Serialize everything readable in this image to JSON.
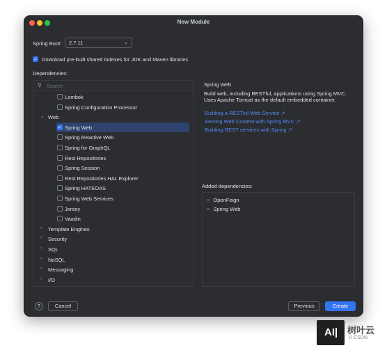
{
  "window": {
    "title": "New Module"
  },
  "spring_boot": {
    "label": "Spring Boot:",
    "value": "2.7.11"
  },
  "download_shared_indexes": {
    "checked": true,
    "label": "Download pre-built shared indexes for JDK and Maven libraries"
  },
  "dependencies": {
    "label": "Dependencies:",
    "search_placeholder": "Search",
    "items": [
      {
        "label": "Lombok",
        "checked": false
      },
      {
        "label": "Spring Configuration Processor",
        "checked": false
      },
      {
        "label": "Web",
        "group": true,
        "expanded": true
      },
      {
        "label": "Spring Web",
        "checked": true,
        "selected": true
      },
      {
        "label": "Spring Reactive Web",
        "checked": false
      },
      {
        "label": "Spring for GraphQL",
        "checked": false
      },
      {
        "label": "Rest Repositories",
        "checked": false
      },
      {
        "label": "Spring Session",
        "checked": false
      },
      {
        "label": "Rest Repositories HAL Explorer",
        "checked": false
      },
      {
        "label": "Spring HATEOAS",
        "checked": false
      },
      {
        "label": "Spring Web Services",
        "checked": false
      },
      {
        "label": "Jersey",
        "checked": false
      },
      {
        "label": "Vaadin",
        "checked": false
      },
      {
        "label": "Template Engines",
        "group": true,
        "expanded": false
      },
      {
        "label": "Security",
        "group": true,
        "expanded": false
      },
      {
        "label": "SQL",
        "group": true,
        "expanded": false
      },
      {
        "label": "NoSQL",
        "group": true,
        "expanded": false
      },
      {
        "label": "Messaging",
        "group": true,
        "expanded": false
      },
      {
        "label": "I/O",
        "group": true,
        "expanded": false
      }
    ]
  },
  "details": {
    "title": "Spring Web",
    "description": "Build web, including RESTful, applications using Spring MVC. Uses Apache Tomcat as the default embedded container.",
    "links": [
      "Building a RESTful Web Service ↗",
      "Serving Web Content with Spring MVC ↗",
      "Building REST services with Spring ↗"
    ]
  },
  "added": {
    "label": "Added dependencies:",
    "items": [
      "OpenFeign",
      "Spring Web"
    ]
  },
  "footer": {
    "help": "?",
    "cancel": "Cancel",
    "previous": "Previous",
    "create": "Create"
  },
  "watermark": {
    "logo": "AI",
    "text": "树叶云",
    "sub": "© CSDN"
  },
  "colors": {
    "accent": "#3574f0",
    "link": "#548af7",
    "window_bg": "#2b2d30",
    "selection": "#2e436e"
  }
}
